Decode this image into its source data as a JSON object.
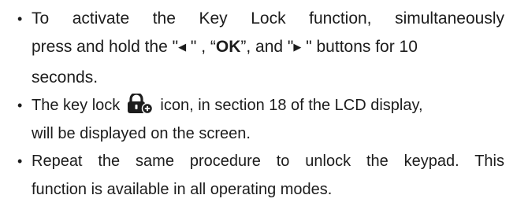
{
  "bullet_char": "•",
  "bullets": [
    {
      "lines": [
        "To activate the Key Lock function, simultaneously",
        "seconds."
      ],
      "line2": {
        "pre": "press and hold the \"",
        "left_arrow": "◀",
        "mid1": " \" , “",
        "ok": "OK",
        "mid2": "”, and \"",
        "right_arrow": "▶",
        "post": " \" buttons for 10"
      }
    },
    {
      "line1_pre": "The key lock",
      "line1_post": "icon, in section 18 of the LCD display,",
      "line2": "will be displayed on the screen.",
      "icon": "key-lock-icon"
    },
    {
      "lines": [
        "Repeat the same procedure to unlock the keypad. This",
        "function is available in all operating modes."
      ]
    }
  ]
}
